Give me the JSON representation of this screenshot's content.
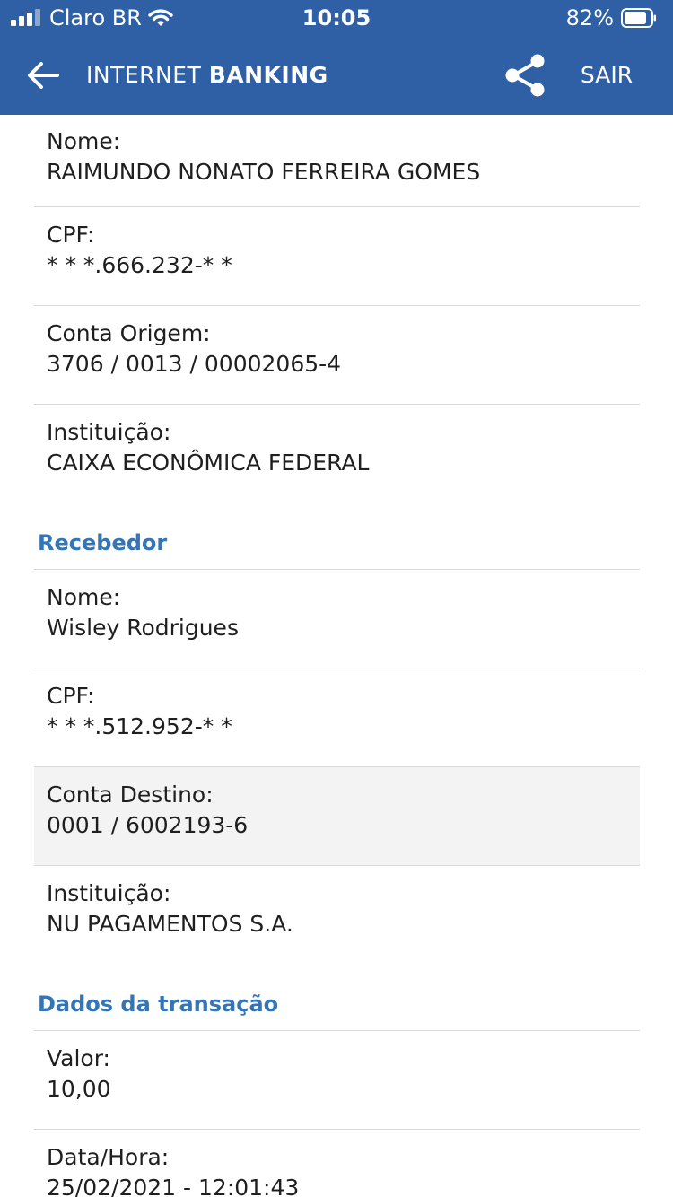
{
  "status_bar": {
    "carrier": "Claro BR",
    "time": "10:05",
    "battery": "82%"
  },
  "header": {
    "title_light": "INTERNET ",
    "title_bold": "BANKING",
    "logout_label": "SAIR"
  },
  "payer": {
    "name_label": "Nome:",
    "name_value": "RAIMUNDO NONATO FERREIRA GOMES",
    "cpf_label": "CPF:",
    "cpf_value": "* * *.666.232-* *",
    "account_label": "Conta Origem:",
    "account_value": "3706 / 0013 / 00002065-4",
    "institution_label": "Instituição:",
    "institution_value": "CAIXA ECONÔMICA FEDERAL"
  },
  "receiver": {
    "section_title": "Recebedor",
    "name_label": "Nome:",
    "name_value": "Wisley Rodrigues",
    "cpf_label": "CPF:",
    "cpf_value": "* * *.512.952-* *",
    "account_label": "Conta Destino:",
    "account_value": "0001 / 6002193-6",
    "institution_label": "Instituição:",
    "institution_value": "NU PAGAMENTOS S.A."
  },
  "transaction": {
    "section_title": "Dados da transação",
    "value_label": "Valor:",
    "value_value": "10,00",
    "datetime_label": "Data/Hora:",
    "datetime_value": "25/02/2021 - 12:01:43"
  },
  "colors": {
    "header_bg": "#2f5fa5",
    "section_title": "#3574b5",
    "highlight_row": "#f4f3f3"
  }
}
